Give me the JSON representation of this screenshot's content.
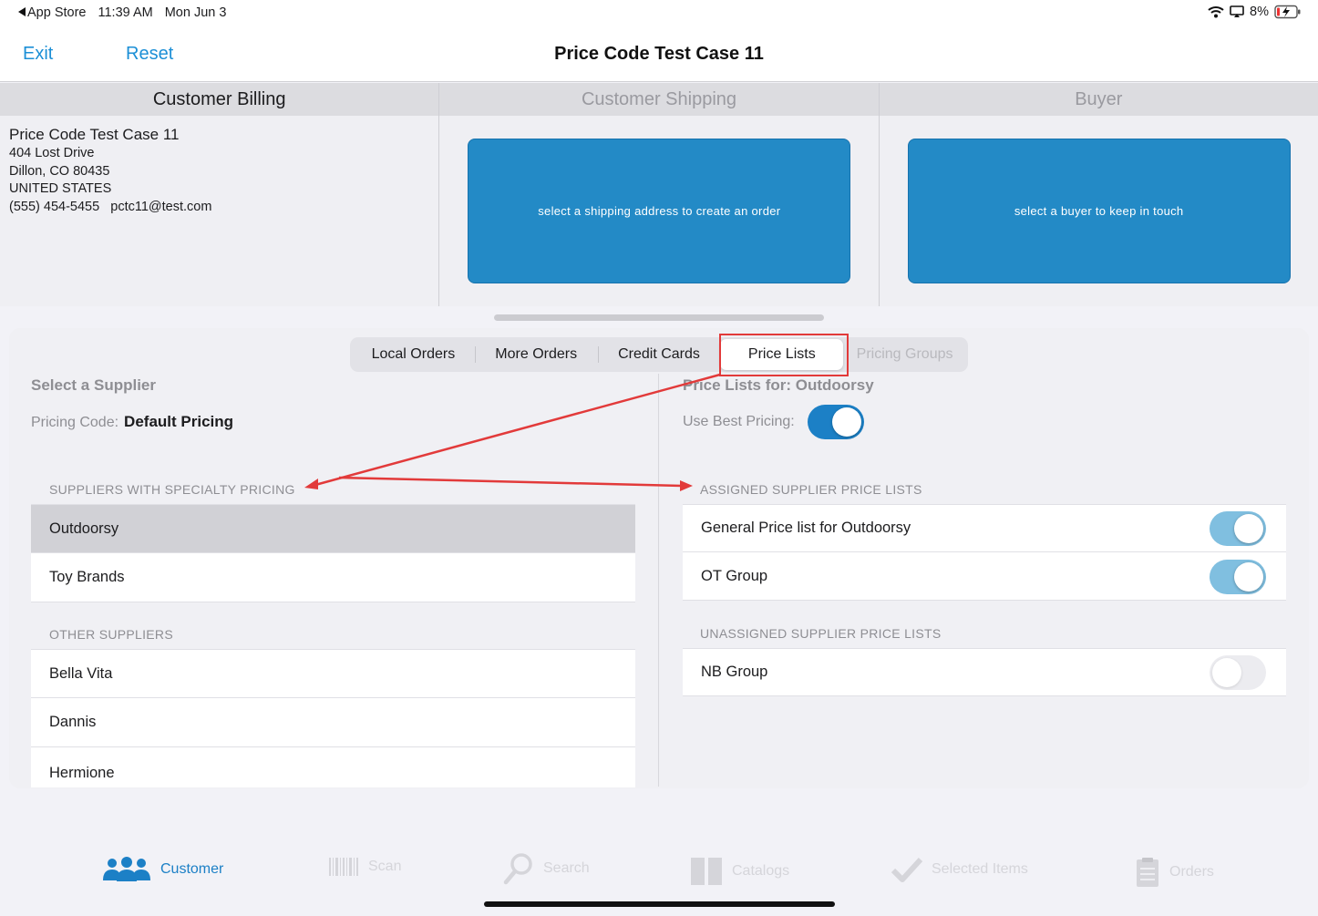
{
  "status_bar": {
    "back_app": "App Store",
    "time": "11:39 AM",
    "date": "Mon Jun 3",
    "battery": "8%"
  },
  "nav": {
    "exit": "Exit",
    "reset": "Reset",
    "title": "Price Code Test Case 11"
  },
  "panels": {
    "billing": {
      "title": "Customer Billing",
      "name": "Price Code Test Case 11",
      "street": "404 Lost Drive",
      "city": "Dillon, CO  80435",
      "country": "UNITED STATES",
      "phone": "(555) 454-5455",
      "email": "pctc11@test.com"
    },
    "shipping": {
      "title": "Customer Shipping",
      "button": "select a shipping address to create an order"
    },
    "buyer": {
      "title": "Buyer",
      "button": "select a buyer to keep in touch"
    }
  },
  "segments": [
    {
      "label": "Local Orders",
      "selected": false,
      "disabled": false
    },
    {
      "label": "More Orders",
      "selected": false,
      "disabled": false
    },
    {
      "label": "Credit Cards",
      "selected": false,
      "disabled": false
    },
    {
      "label": "Price Lists",
      "selected": true,
      "disabled": false
    },
    {
      "label": "Pricing Groups",
      "selected": false,
      "disabled": true
    }
  ],
  "left": {
    "section_title": "Select a Supplier",
    "pricing_code_label": "Pricing Code:",
    "pricing_code_value": "Default Pricing",
    "specialty_header": "SUPPLIERS WITH SPECIALTY PRICING",
    "specialty": [
      "Outdoorsy",
      "Toy Brands"
    ],
    "other_header": "OTHER SUPPLIERS",
    "others": [
      "Bella Vita",
      "Dannis",
      "Hermione"
    ]
  },
  "right": {
    "section_title": "Price Lists for: Outdoorsy",
    "best_pricing_label": "Use Best Pricing:",
    "best_pricing": true,
    "assigned_header": "ASSIGNED SUPPLIER PRICE LISTS",
    "assigned": [
      {
        "name": "General Price list for Outdoorsy",
        "on": true
      },
      {
        "name": "OT Group",
        "on": true
      }
    ],
    "unassigned_header": "UNASSIGNED SUPPLIER PRICE LISTS",
    "unassigned": [
      {
        "name": "NB Group",
        "on": false
      }
    ]
  },
  "tabbar": [
    {
      "label": "Customer",
      "icon": "people-icon",
      "active": true
    },
    {
      "label": "Scan",
      "icon": "barcode-icon",
      "active": false
    },
    {
      "label": "Search",
      "icon": "magnifier-icon",
      "active": false
    },
    {
      "label": "Catalogs",
      "icon": "book-icon",
      "active": false
    },
    {
      "label": "Selected Items",
      "icon": "checkmark-icon",
      "active": false
    },
    {
      "label": "Orders",
      "icon": "clipboard-icon",
      "active": false
    }
  ],
  "colors": {
    "accent": "#1c80c6",
    "annotation": "#e23a3a"
  }
}
